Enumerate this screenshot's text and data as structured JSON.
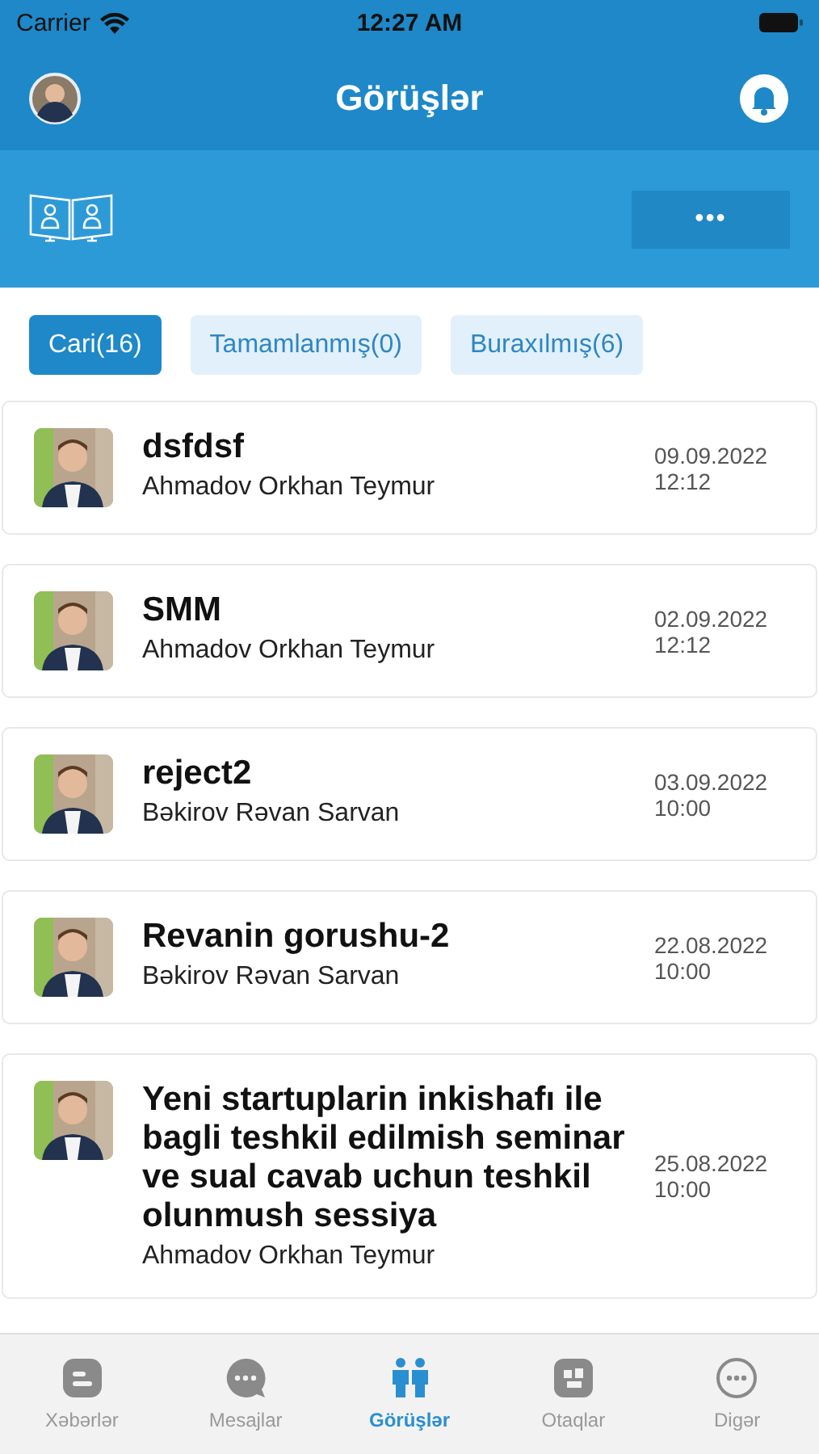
{
  "status_bar": {
    "carrier": "Carrier",
    "time": "12:27 AM"
  },
  "header": {
    "title": "Görüşlər"
  },
  "toolbar": {
    "more_button": "•••"
  },
  "filters": [
    {
      "label": "Cari(16)",
      "selected": true
    },
    {
      "label": "Tamamlanmış(0)",
      "selected": false
    },
    {
      "label": "Buraxılmış(6)",
      "selected": false
    }
  ],
  "meetings": [
    {
      "title": "dsfdsf",
      "person": "Ahmadov Orkhan Teymur",
      "date": "09.09.2022",
      "time": "12:12"
    },
    {
      "title": "SMM",
      "person": "Ahmadov Orkhan Teymur",
      "date": "02.09.2022",
      "time": "12:12"
    },
    {
      "title": "reject2",
      "person": "Bəkirov Rəvan Sarvan",
      "date": "03.09.2022",
      "time": "10:00"
    },
    {
      "title": "Revanin gorushu-2",
      "person": "Bəkirov Rəvan Sarvan",
      "date": "22.08.2022",
      "time": "10:00"
    },
    {
      "title": "Yeni startuplarin inkishafı ile bagli teshkil edilmish seminar ve sual cavab uchun teshkil olunmush sessiya",
      "person": "Ahmadov Orkhan Teymur",
      "date": "25.08.2022",
      "time": "10:00"
    }
  ],
  "tab_bar": [
    {
      "label": "Xəbərlər",
      "kind": "news",
      "selected": false
    },
    {
      "label": "Mesajlar",
      "kind": "chat",
      "selected": false
    },
    {
      "label": "Görüşlər",
      "kind": "people",
      "selected": true
    },
    {
      "label": "Otaqlar",
      "kind": "rooms",
      "selected": false
    },
    {
      "label": "Digər",
      "kind": "more",
      "selected": false
    }
  ]
}
